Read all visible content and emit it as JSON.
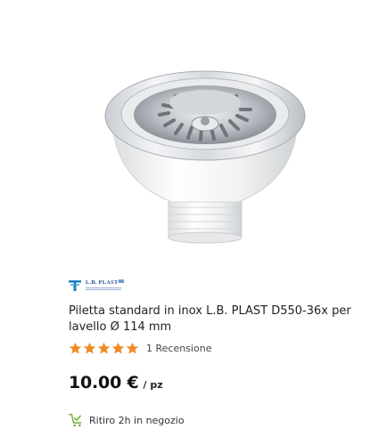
{
  "product": {
    "brand": {
      "logo_text": "L.B. PLAST",
      "logo_icon": "lb-plast-logo"
    },
    "title": "Piletta standard in inox L.B. PLAST D550-36x per lavello Ø 114 mm",
    "rating": {
      "stars": 5,
      "max_stars": 5,
      "review_text": "1 Recensione",
      "star_color": "#f08a24"
    },
    "price": {
      "value": "10.00 €",
      "unit": "/ pz"
    },
    "availability": {
      "pickup_text": "Ritiro 2h in negozio",
      "pickup_icon": "cart-check-icon",
      "icon_color": "#7cb342"
    }
  }
}
